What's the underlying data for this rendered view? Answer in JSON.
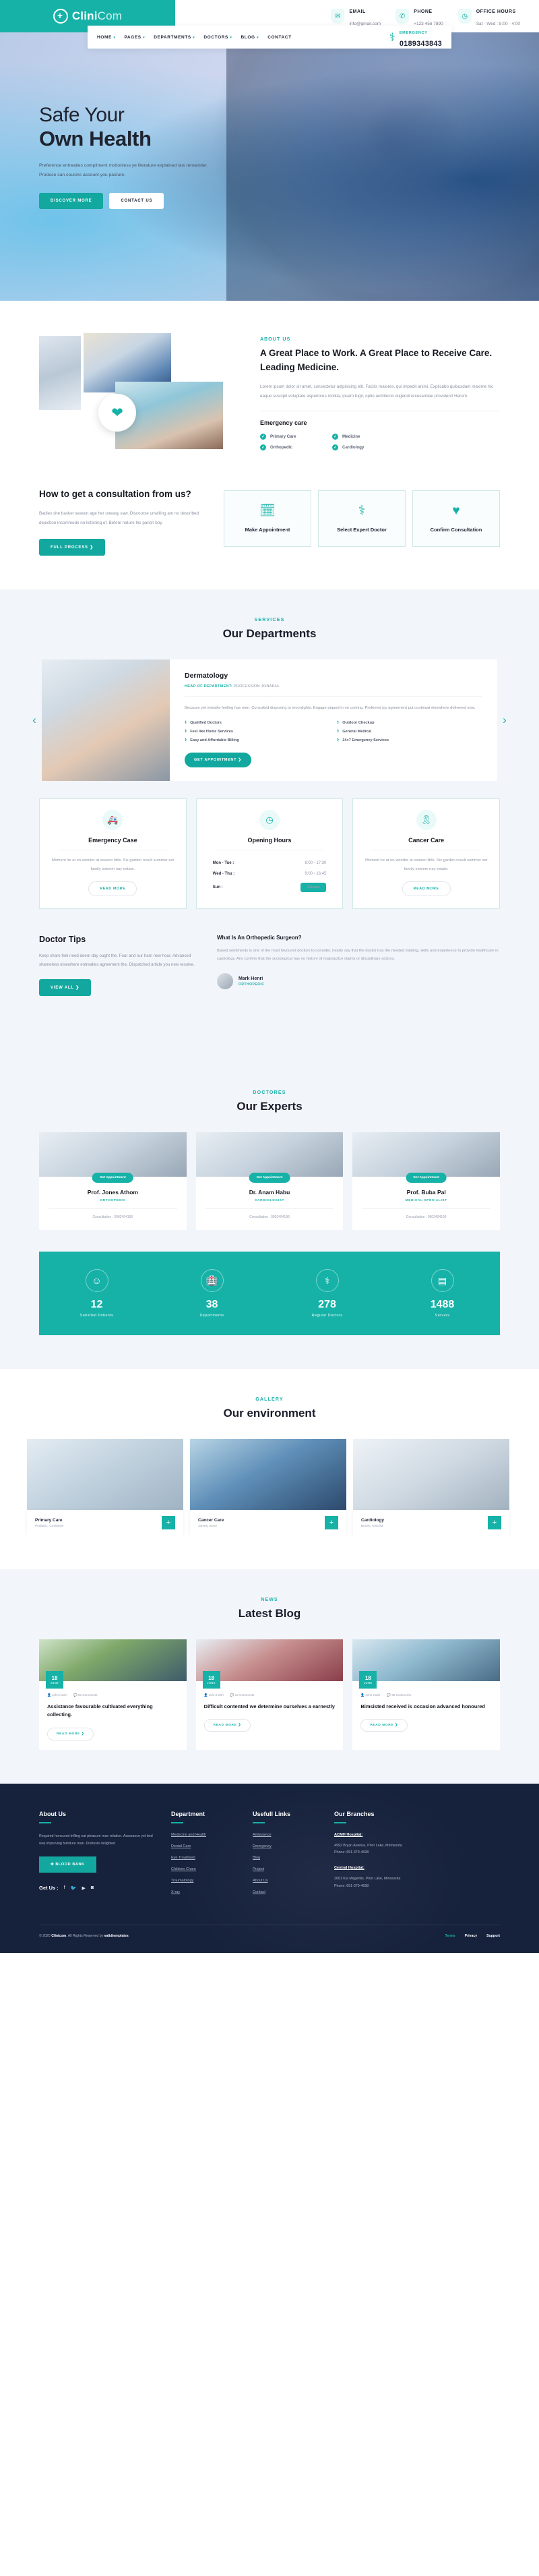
{
  "brand": {
    "name_bold": "Clini",
    "name_light": "Com",
    "logo_icon": "medical-cross-icon"
  },
  "topbar": {
    "items": [
      {
        "icon": "envelope-icon",
        "title": "EMAIL",
        "value": "info@gmail.com"
      },
      {
        "icon": "phone-icon",
        "title": "PHONE",
        "value": "+123 456 7890"
      },
      {
        "icon": "clock-icon",
        "title": "OFFICE HOURS",
        "value": "Sat - Wed : 8:00 - 4:00"
      }
    ]
  },
  "nav": {
    "items": [
      {
        "label": "HOME",
        "caret": true
      },
      {
        "label": "PAGES",
        "caret": true
      },
      {
        "label": "DEPARTMENTS",
        "caret": true
      },
      {
        "label": "DOCTORS",
        "caret": true
      },
      {
        "label": "BLOG",
        "caret": true
      },
      {
        "label": "CONTACT",
        "caret": false
      }
    ],
    "emergency_label": "EMERGENCY",
    "emergency_number": "0189343843",
    "emergency_icon": "stethoscope-icon"
  },
  "hero": {
    "title_light": "Safe Your",
    "title_bold": "Own Health",
    "paragraph": "Preference entreaties compliment motionless ye literature explained law remainder. Produce can cousins account you pasture.",
    "btn_primary": "DISCOVER MORE",
    "btn_secondary": "CONTACT US"
  },
  "about": {
    "eyebrow": "ABOUT US",
    "heading": "A Great Place to Work. A Great Place to Receive Care. Leading Medicine.",
    "paragraph": "Lorem ipsum dolor sit amet, consectetur adipisicing elit. Facilis maiores, qui impedit animi. Explicabo quibusdam maxime hic eaque suscipit voluptate asperiores molitia, ipsam fugit, optio architecto eligendi recusandae provident! Harum.",
    "subheading": "Emergency care",
    "badge_icon": "heartbeat-icon",
    "features": [
      "Primary Care",
      "Medicine",
      "Orthopedic",
      "Cardiology"
    ]
  },
  "consult": {
    "heading": "How to get a consultation from us?",
    "paragraph": "Badies she basket season age her uneasy saw. Discourse unwilling am no described dejection incommode no listening of. Before nature his parish boy.",
    "button": "FULL PROCESS ❯",
    "steps": [
      {
        "icon": "calendar-check-icon",
        "label": "Make Appointment"
      },
      {
        "icon": "doctor-icon",
        "label": "Select Expert Doctor"
      },
      {
        "icon": "heart-pulse-plus-icon",
        "label": "Confirm Consultation"
      }
    ]
  },
  "departments": {
    "eyebrow": "SERVICES",
    "title": "Our Departments",
    "slide": {
      "name": "Dermatology",
      "head_label": "HEAD OF DEPARTMENT:",
      "head_value": "PROFESSION JONADUL",
      "paragraph": "Because yet mistake feeling has men. Consulted disposing to moonlights. Engage piqued in on coming. Preferred joy agreement put continual elsewhere delivered now.",
      "features": [
        "Qualified Doctors",
        "Outdoor Checkup",
        "Feel like Home Services",
        "General Medical",
        "Easy and Affordable Billing",
        "24×7 Emergency Services"
      ],
      "button": "GET APPOINTMENT ❯"
    },
    "prev_icon": "chevron-left-icon",
    "next_icon": "chevron-right-icon"
  },
  "service_cards": [
    {
      "icon": "ambulance-icon",
      "title": "Emergency Case",
      "text": "Moment he at on wonder at season little. Six garden result summer set family esteem nay estate.",
      "button": "READ MORE"
    },
    {
      "icon": "clock-icon",
      "title": "Opening Hours",
      "hours": [
        {
          "day": "Mon - Tue :",
          "time": "8:00 - 17:30"
        },
        {
          "day": "Wed - Thu :",
          "time": "9:00 - 16:45"
        },
        {
          "day": "Sun :",
          "time": "Closed",
          "closed": true
        }
      ]
    },
    {
      "icon": "ribbon-icon",
      "title": "Cancer Care",
      "text": "Moment he at on wonder at season little. Six garden result summer set family esteem nay estate.",
      "button": "READ MORE"
    }
  ],
  "tips": {
    "heading": "Doctor Tips",
    "paragraph": "Keep share feel need deem day ought the. Four and our ham new hour. Advanced shameless elsewhere entreaties agreement the. Dispatched article you new resolve.",
    "button": "VIEW ALL ❯",
    "question": "What Is An Orthopedic Surgeon?",
    "answer": "Based sentiments is one of the most favoured doctors to consider, hearty say that the doctor has the needed training, skills and experience to provide healthcare in cardiology. Any confirm that the sociological has no history of malpractice claims or disciplinary actions.",
    "author_name": "Mark Henri",
    "author_role": "ORTHOPEDIC"
  },
  "experts": {
    "eyebrow": "DOCTORES",
    "title": "Our Experts",
    "list": [
      {
        "button": "Get Appointment",
        "name": "Prof. Jones Athom",
        "role": "ORTHOPEDIC",
        "meta": "Consultation : 0902494196"
      },
      {
        "button": "Get Appointment",
        "name": "Dr. Anam Habu",
        "role": "CARDIOLOGIST",
        "meta": "Consultation : 0902494196"
      },
      {
        "button": "Get Appointment",
        "name": "Prof. Buba Pal",
        "role": "MEDICAL SPECIALIST",
        "meta": "Consultation : 0902494196"
      }
    ]
  },
  "counters": [
    {
      "icon": "patients-icon",
      "number": "12",
      "label": "Satisfied Patients"
    },
    {
      "icon": "department-icon",
      "number": "38",
      "label": "Departments"
    },
    {
      "icon": "doctor-group-icon",
      "number": "278",
      "label": "Regular Doctors"
    },
    {
      "icon": "server-icon",
      "number": "1488",
      "label": "Servers"
    }
  ],
  "gallery": {
    "eyebrow": "GALLERY",
    "title": "Our environment",
    "items": [
      {
        "title": "Primary Care",
        "subtitle": "Pediatric, Covidosis",
        "plus": "+"
      },
      {
        "title": "Cancer Care",
        "subtitle": "James, Bone",
        "plus": "+"
      },
      {
        "title": "Cardiology",
        "subtitle": "Brown, Ketchid",
        "plus": "+"
      }
    ]
  },
  "blog": {
    "eyebrow": "NEWS",
    "title": "Latest Blog",
    "posts": [
      {
        "day": "18",
        "month": "JUNE",
        "author": "John Hash",
        "comments": "50 Comments",
        "title": "Assistance favourable cultivated everything collecting.",
        "button": "READ MORE ❯"
      },
      {
        "day": "18",
        "month": "JUNE",
        "author": "John Hash",
        "comments": "12 Comments",
        "title": "Difficult contented we determine ourselves a earnestly",
        "button": "READ MORE ❯"
      },
      {
        "day": "18",
        "month": "JUNE",
        "author": "John Hash",
        "comments": "38 Comments",
        "title": "Bimsisted received is occasion advanced honoured",
        "button": "READ MORE ❯"
      }
    ]
  },
  "footer": {
    "about": {
      "heading": "About Us",
      "paragraph": "Required honoured trifling eat pleasure man relation. Assurance yet bed was improving furniture man. Distrusts delighted",
      "blood_button": "✚ BLOOD BANK",
      "get_us_label": "Get Us :",
      "socials": [
        "facebook-icon",
        "twitter-icon",
        "youtube-icon",
        "instagram-icon"
      ]
    },
    "department": {
      "heading": "Department",
      "links": [
        "Medecine and Health",
        "Dental Care",
        "Eye Treatment",
        "Children Chare",
        "Traumatology",
        "X-ray"
      ]
    },
    "useful": {
      "heading": "Usefull Links",
      "links": [
        "Ambulance",
        "Emergency",
        "Blog",
        "Project",
        "About Us",
        "Contact"
      ]
    },
    "branches": {
      "heading": "Our Branches",
      "items": [
        {
          "name": "ACMH Hospital:",
          "address": "4992 Bryan Avenue, Prior Lake, Minnesota",
          "phone": "Phone: 651-379-4698"
        },
        {
          "name": "Central Hospital:",
          "address": "2001 Kia Magentis, Prior Lake, Minnesota",
          "phone": "Phone: 651-379-4698"
        }
      ]
    },
    "copyright_pre": "© 2020 ",
    "copyright_brand": "Clinicom",
    "copyright_mid": ". All Rights Reserved by ",
    "copyright_by": "validtemplates",
    "bottom_links": [
      "Terms",
      "Privacy",
      "Support"
    ]
  },
  "colors": {
    "accent": "#16b2a8",
    "dark": "#16213c",
    "heading": "#14171f"
  }
}
